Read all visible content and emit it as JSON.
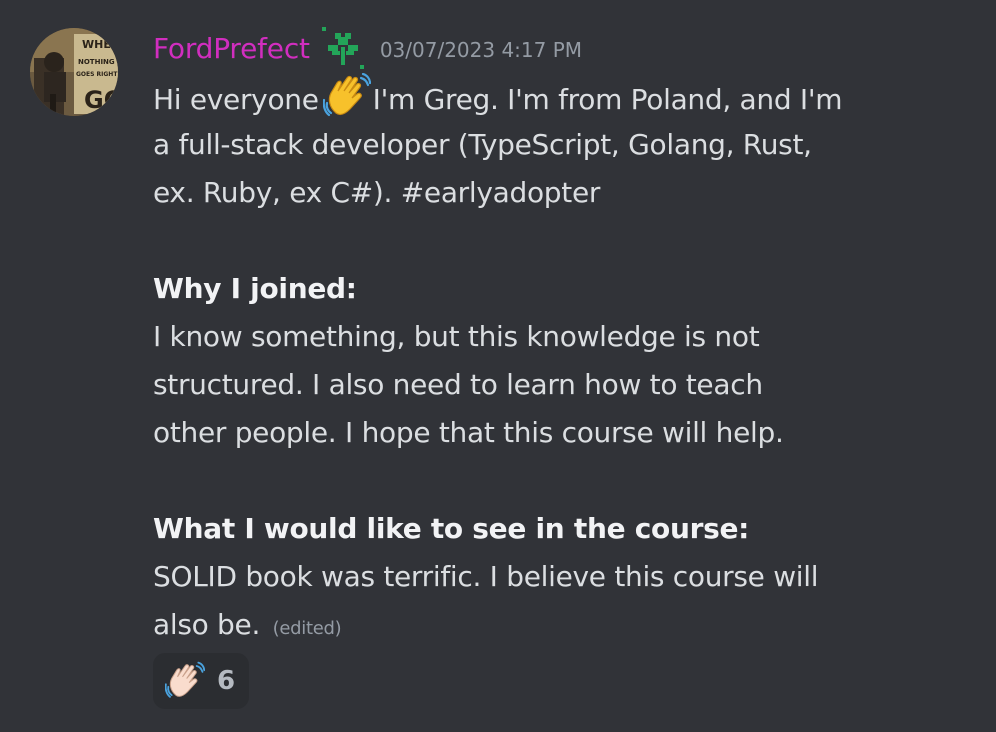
{
  "message": {
    "author": {
      "username": "FordPrefect",
      "username_color": "#d12ebf",
      "avatar_icon": "avatar-photo",
      "avatar_text": "WHEN NOTHING GOES RIGHT GO",
      "role_icon": "sprout-icon"
    },
    "timestamp": "03/07/2023 4:17 PM",
    "lines": {
      "l1_pre": "Hi everyone",
      "l1_post": "I'm Greg. I'm from Poland, and I'm",
      "l2": "a full-stack developer (TypeScript, Golang, Rust,",
      "l3": "ex. Ruby, ex C#).  #earlyadopter",
      "why_heading": "Why I joined:",
      "why_1": "I know something, but this knowledge is not",
      "why_2": "structured. I also need to learn how to teach",
      "why_3": "other people. I hope that this course will help.",
      "see_heading": "What I would like to see in the course:",
      "see_1": "SOLID book was terrific. I believe this course will",
      "see_2": "also be."
    },
    "inline_emoji": "waving-hand-emoji",
    "edited_label": "(edited)",
    "reactions": [
      {
        "emoji": "waving-hand-emoji",
        "count": "6"
      }
    ]
  }
}
